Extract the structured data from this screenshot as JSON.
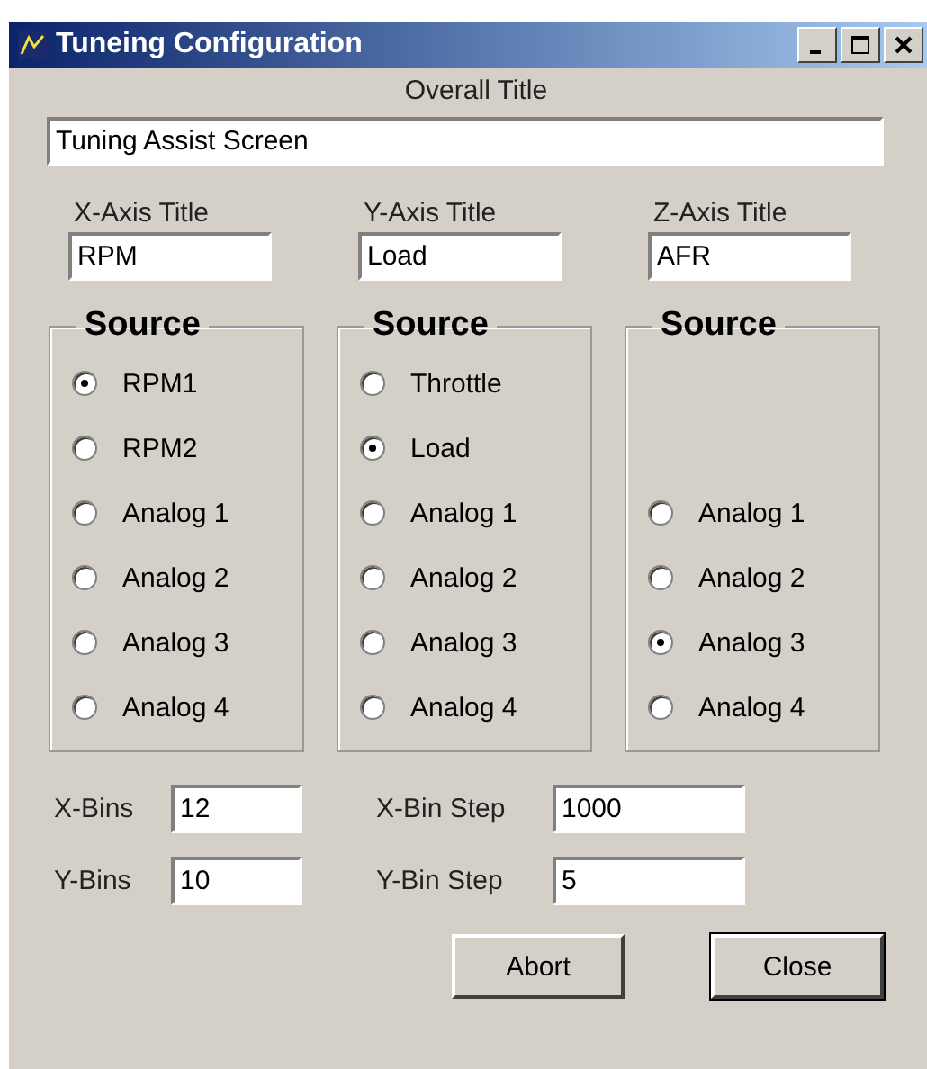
{
  "window": {
    "title": "Tuneing Configuration"
  },
  "overall_title": {
    "label": "Overall Title",
    "value": "Tuning Assist Screen"
  },
  "axis_titles": [
    {
      "label": "X-Axis Title",
      "value": "RPM"
    },
    {
      "label": "Y-Axis Title",
      "value": "Load"
    },
    {
      "label": "Z-Axis Title",
      "value": "AFR"
    }
  ],
  "source_groups": [
    {
      "title": "Source",
      "options": [
        {
          "label": "RPM1",
          "selected": true
        },
        {
          "label": "RPM2",
          "selected": false
        },
        {
          "label": "Analog 1",
          "selected": false
        },
        {
          "label": "Analog 2",
          "selected": false
        },
        {
          "label": "Analog 3",
          "selected": false
        },
        {
          "label": "Analog 4",
          "selected": false
        }
      ]
    },
    {
      "title": "Source",
      "options": [
        {
          "label": "Throttle",
          "selected": false
        },
        {
          "label": "Load",
          "selected": true
        },
        {
          "label": "Analog 1",
          "selected": false
        },
        {
          "label": "Analog 2",
          "selected": false
        },
        {
          "label": "Analog 3",
          "selected": false
        },
        {
          "label": "Analog 4",
          "selected": false
        }
      ]
    },
    {
      "title": "Source",
      "options": [
        {
          "label": "Analog 1",
          "selected": false
        },
        {
          "label": "Analog 2",
          "selected": false
        },
        {
          "label": "Analog 3",
          "selected": true
        },
        {
          "label": "Analog 4",
          "selected": false
        }
      ]
    }
  ],
  "bins": [
    {
      "label": "X-Bins",
      "value": "12",
      "step_label": "X-Bin Step",
      "step_value": "1000"
    },
    {
      "label": "Y-Bins",
      "value": "10",
      "step_label": "Y-Bin Step",
      "step_value": "5"
    }
  ],
  "buttons": [
    {
      "label": "Abort",
      "default": false
    },
    {
      "label": "Close",
      "default": true
    }
  ]
}
